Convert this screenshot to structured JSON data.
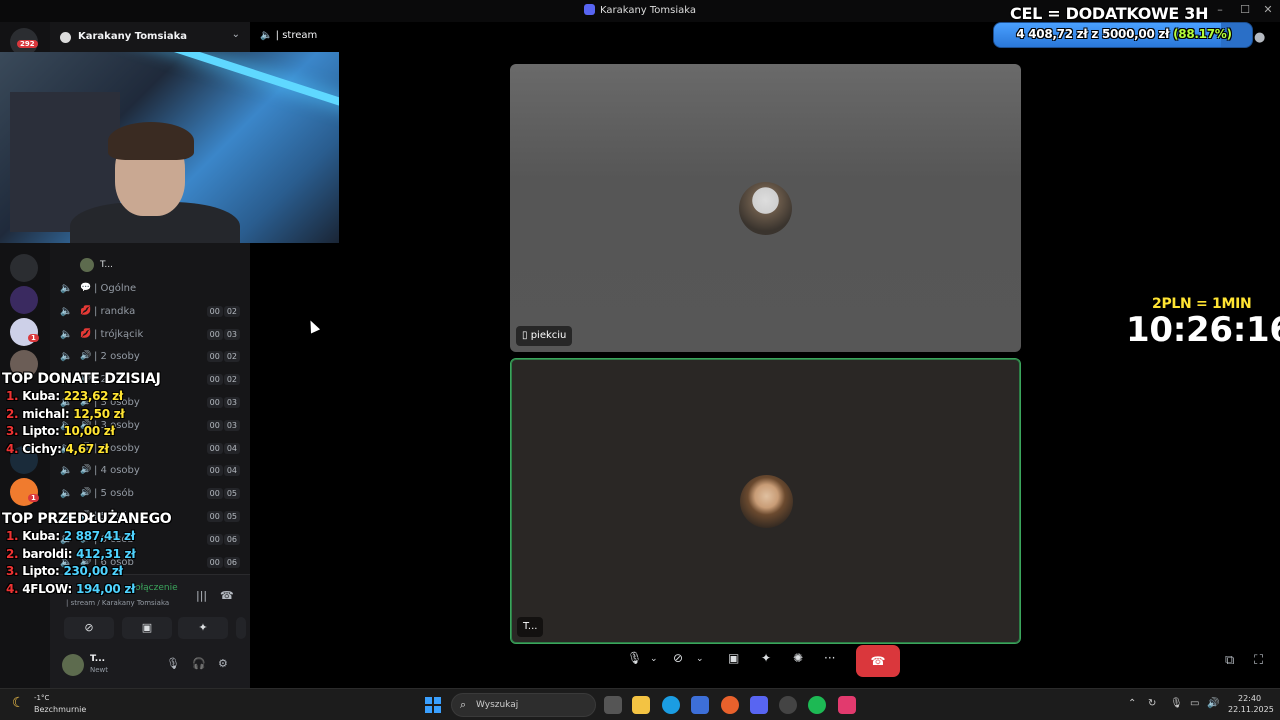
{
  "window": {
    "title": "Karakany Tomsiaka"
  },
  "rail": {
    "badge_top": "292",
    "badge_small": "1"
  },
  "server": {
    "name": "Karakany Tomsiaka",
    "header_channel": "| stream",
    "member_label": "T...",
    "channels": [
      {
        "emoji": "💬",
        "label": "| Ogólne",
        "a": "",
        "b": ""
      },
      {
        "emoji": "💋",
        "label": "| randka",
        "a": "00",
        "b": "02"
      },
      {
        "emoji": "💋",
        "label": "| trójkącik",
        "a": "00",
        "b": "03"
      },
      {
        "emoji": "🔊",
        "label": "| 2 osoby",
        "a": "00",
        "b": "02"
      },
      {
        "emoji": "🔊",
        "label": "| 2 osoby",
        "a": "00",
        "b": "02"
      },
      {
        "emoji": "🔊",
        "label": "| 3 osoby",
        "a": "00",
        "b": "03"
      },
      {
        "emoji": "🔊",
        "label": "| 3 osoby",
        "a": "00",
        "b": "03"
      },
      {
        "emoji": "🔊",
        "label": "| 4 osoby",
        "a": "00",
        "b": "04"
      },
      {
        "emoji": "🔊",
        "label": "| 4 osoby",
        "a": "00",
        "b": "04"
      },
      {
        "emoji": "🔊",
        "label": "| 5 osób",
        "a": "00",
        "b": "05"
      },
      {
        "emoji": "🔊",
        "label": "| 5 osób",
        "a": "00",
        "b": "05"
      },
      {
        "emoji": "🔊",
        "label": "| 6 osób",
        "a": "00",
        "b": "06"
      },
      {
        "emoji": "🔊",
        "label": "| 6 osób",
        "a": "00",
        "b": "06"
      }
    ],
    "voice_status": "Połączenie",
    "voice_sub": "| stream / Karakany Tomsiaka",
    "user_name": "T...",
    "user_status": "Newt"
  },
  "overlay": {
    "top_donate_title": "TOP DONATE DZISIAJ",
    "top_donate": [
      {
        "rank": "1.",
        "name": "Kuba:",
        "amount": "223,62 zł"
      },
      {
        "rank": "2.",
        "name": "michal:",
        "amount": "12,50 zł"
      },
      {
        "rank": "3.",
        "name": "Lipto:",
        "amount": "10,00 zł"
      },
      {
        "rank": "4.",
        "name": "Cichy:",
        "amount": "4,67 zł"
      }
    ],
    "top_extend_title": "TOP PRZEDŁUŻANEGO",
    "top_extend": [
      {
        "rank": "1.",
        "name": "Kuba:",
        "amount": "2 887,41 zł"
      },
      {
        "rank": "2.",
        "name": "baroldi:",
        "amount": "412,31 zł"
      },
      {
        "rank": "3.",
        "name": "Lipto:",
        "amount": "230,00 zł"
      },
      {
        "rank": "4.",
        "name": "4FLOW:",
        "amount": "194,00 zł"
      }
    ],
    "goal_title": "CEL = DODATKOWE 3H",
    "goal_current": "4 408,72 zł",
    "goal_z": "z",
    "goal_target": "5000,00 zł",
    "goal_percent": "(88.17%)",
    "goal_fraction": 0.8817,
    "timer_rate": "2PLN = 1MIN",
    "timer": "10:26:16"
  },
  "call": {
    "tile1_name": "piekciu",
    "tile2_name": "T..."
  },
  "taskbar": {
    "temp": "-1°C",
    "weather": "Bezchmurnie",
    "search_placeholder": "Wyszukaj",
    "time": "22:40",
    "date": "22.11.2025"
  },
  "colors": {
    "accent": "#5865f2",
    "hangup": "#da373c",
    "speaking": "#3ba55c",
    "goal": "#2a77d8"
  }
}
